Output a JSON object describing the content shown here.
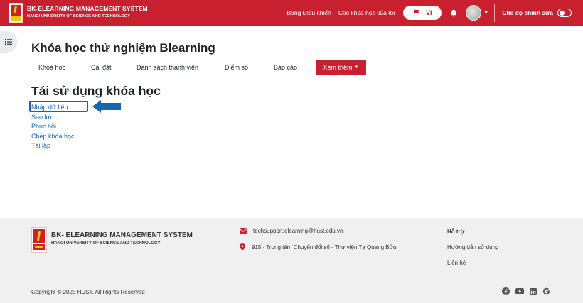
{
  "header": {
    "brand_title": "BK-ELEARNING MANAGEMENT SYSTEM",
    "brand_sub": "HANOI UNIVERSITY OF SCIENCE AND TECHNOLOGY",
    "logo_text": "BÁCH KHOA",
    "links": [
      "Bảng Điều khiển",
      "Các khoá học của tôi"
    ],
    "language": "VI",
    "edit_mode_label": "Chế độ chỉnh sửa",
    "edit_mode_on": false,
    "brand_color": "#c8202f"
  },
  "course": {
    "title": "Khóa học thử nghiệm Blearning",
    "tabs": [
      "Khoá học",
      "Cài đặt",
      "Danh sách thành viên",
      "Điểm số",
      "Báo cáo"
    ],
    "more_button": "Xem thêm"
  },
  "main": {
    "heading": "Tái sử dụng khóa học",
    "links": [
      "Nhập dữ liệu",
      "Sao lưu",
      "Phục hồi",
      "Chép khóa học",
      "Tái lập"
    ],
    "highlighted": "Nhập dữ liệu",
    "annotation_color": "#1366b1"
  },
  "footer": {
    "brand_title": "BK- ELEARNING MANAGEMENT SYSTEM",
    "brand_sub": "HANOI UNIVERSITY OF SCIENCE AND TECHNOLOGY",
    "logo_text": "BÁCH KHOA",
    "email": "techsupport.elearning@hust.edu.vn",
    "address": "915 - Trung tâm Chuyển đổi số - Thư viện Tạ Quang Bửu",
    "support_heading": "Hỗ trợ",
    "support_links": [
      "Hướng dẫn sử dụng",
      "Liên hệ"
    ],
    "copyright": "Copyright © 2025 HUST. All Rights Reserved",
    "social_icons": [
      "facebook-icon",
      "youtube-icon",
      "linkedin-icon",
      "google-icon"
    ]
  }
}
